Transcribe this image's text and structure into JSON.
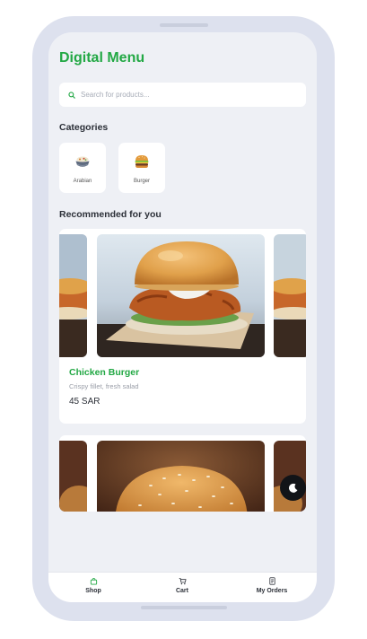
{
  "app": {
    "title": "Digital Menu"
  },
  "search": {
    "placeholder": "Search for products..."
  },
  "categories": {
    "heading": "Categories",
    "items": [
      {
        "label": "Arabian",
        "icon": "rice-bowl-icon"
      },
      {
        "label": "Burger",
        "icon": "burger-icon"
      }
    ]
  },
  "recommended": {
    "heading": "Recommended for you",
    "items": [
      {
        "name": "Chicken Burger",
        "description": "Crispy fillet, fresh salad",
        "price": "45 SAR"
      }
    ]
  },
  "nav": {
    "items": [
      {
        "label": "Shop",
        "icon": "shopping-bag-icon",
        "active": true
      },
      {
        "label": "Cart",
        "icon": "cart-icon",
        "active": false
      },
      {
        "label": "My Orders",
        "icon": "receipt-icon",
        "active": false
      }
    ]
  },
  "theme_toggle": {
    "icon": "moon-icon"
  },
  "colors": {
    "accent": "#22a844",
    "background": "#eef0f5",
    "card": "#ffffff",
    "toggle": "#121418"
  }
}
